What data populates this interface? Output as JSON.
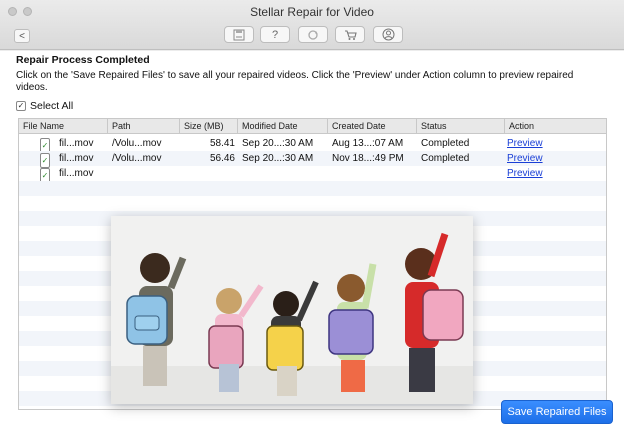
{
  "window": {
    "title": "Stellar Repair for Video"
  },
  "toolbar": {
    "icons": [
      "save-icon",
      "help-icon",
      "refresh-icon",
      "cart-icon",
      "user-icon"
    ],
    "help_glyph": "?"
  },
  "back_glyph": "<",
  "main": {
    "heading": "Repair Process Completed",
    "description": "Click on the 'Save Repaired Files' to save all your repaired videos. Click the 'Preview' under Action column to preview repaired videos.",
    "select_all_label": "Select All",
    "select_all_checked": true
  },
  "table": {
    "columns": [
      "File Name",
      "Path",
      "Size (MB)",
      "Modified Date",
      "Created Date",
      "Status",
      "Action"
    ],
    "rows": [
      {
        "checked": true,
        "name": "fil...mov",
        "path": "/Volu...mov",
        "size": "58.41",
        "modified": "Sep 20...:30 AM",
        "created": "Aug 13...:07 AM",
        "status": "Completed",
        "action": "Preview"
      },
      {
        "checked": true,
        "name": "fil...mov",
        "path": "/Volu...mov",
        "size": "56.46",
        "modified": "Sep 20...:30 AM",
        "created": "Nov 18...:49 PM",
        "status": "Completed",
        "action": "Preview"
      },
      {
        "checked": true,
        "name": "fil...mov",
        "path": "",
        "size": "",
        "modified": "",
        "created": "",
        "status": "",
        "action": "Preview"
      }
    ]
  },
  "check_glyph": "✓",
  "footer": {
    "save_label": "Save Repaired Files"
  },
  "colors": {
    "accent": "#1d6fe8",
    "link": "#1a3fd6",
    "check": "#2e8b2e"
  }
}
